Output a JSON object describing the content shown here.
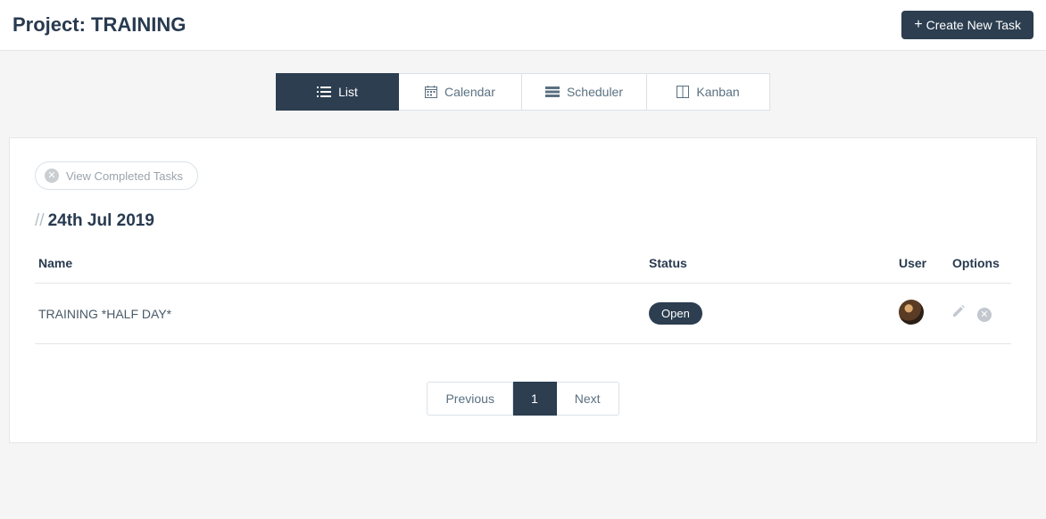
{
  "header": {
    "title": "Project: TRAINING",
    "create_button": "Create New Task"
  },
  "tabs": {
    "list": "List",
    "calendar": "Calendar",
    "scheduler": "Scheduler",
    "kanban": "Kanban"
  },
  "filter": {
    "view_completed": "View Completed Tasks"
  },
  "date_group": "24th Jul 2019",
  "table": {
    "cols": {
      "name": "Name",
      "status": "Status",
      "user": "User",
      "options": "Options"
    },
    "rows": [
      {
        "name": "TRAINING *HALF DAY*",
        "status": "Open"
      }
    ]
  },
  "pagination": {
    "prev": "Previous",
    "next": "Next",
    "current": "1"
  }
}
